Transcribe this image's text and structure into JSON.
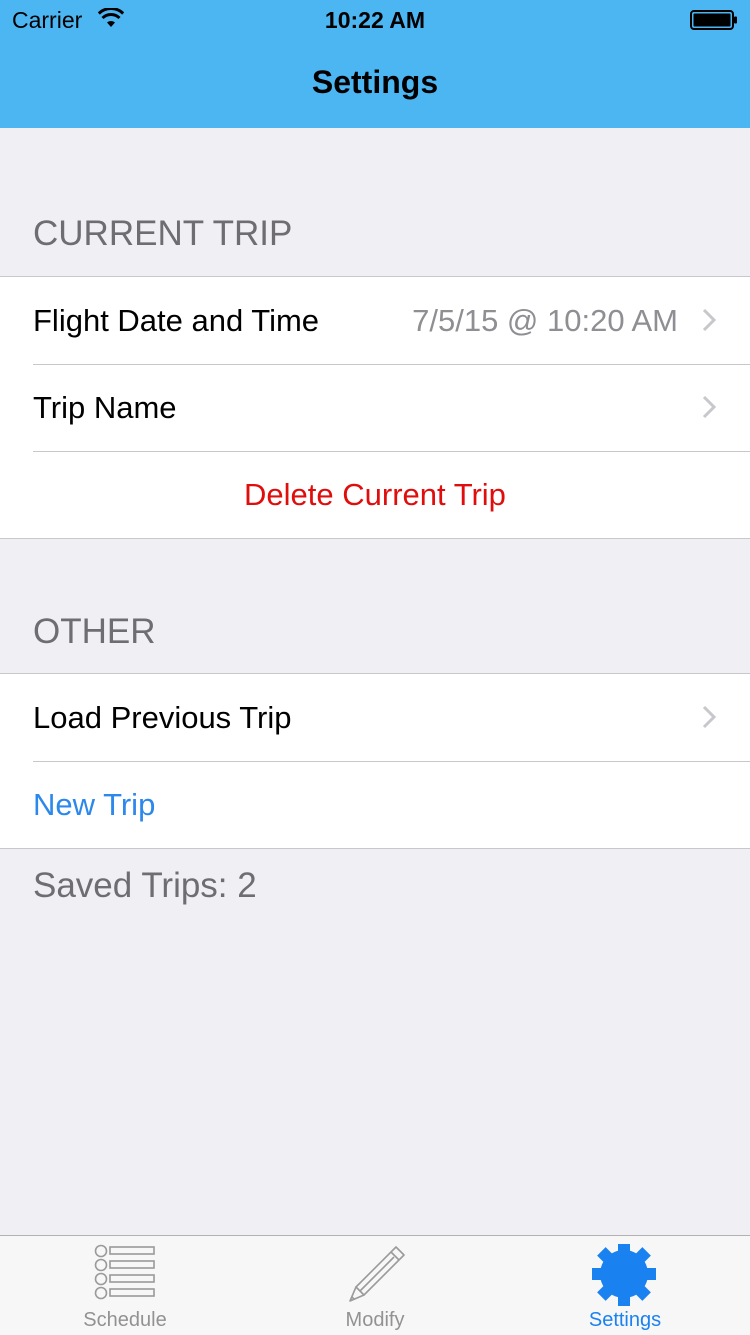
{
  "status_bar": {
    "carrier": "Carrier",
    "time": "10:22 AM"
  },
  "nav": {
    "title": "Settings"
  },
  "sections": {
    "current_trip": {
      "header": "CURRENT TRIP",
      "flight_date_label": "Flight Date and Time",
      "flight_date_value": "7/5/15 @ 10:20 AM",
      "trip_name_label": "Trip Name",
      "delete_label": "Delete Current Trip"
    },
    "other": {
      "header": "OTHER",
      "load_previous_label": "Load Previous Trip",
      "new_trip_label": "New Trip"
    }
  },
  "footer": {
    "saved_trips": "Saved Trips: 2"
  },
  "tabbar": {
    "tabs": [
      {
        "label": "Schedule",
        "icon": "list-icon"
      },
      {
        "label": "Modify",
        "icon": "pencil-icon"
      },
      {
        "label": "Settings",
        "icon": "gear-icon"
      }
    ],
    "active_tab": "Settings"
  },
  "colors": {
    "nav_bar": "#4cb6f3",
    "destructive": "#e00d0d",
    "link": "#2d88eb",
    "tab_active": "#1a82f0",
    "background": "#efeff4"
  }
}
